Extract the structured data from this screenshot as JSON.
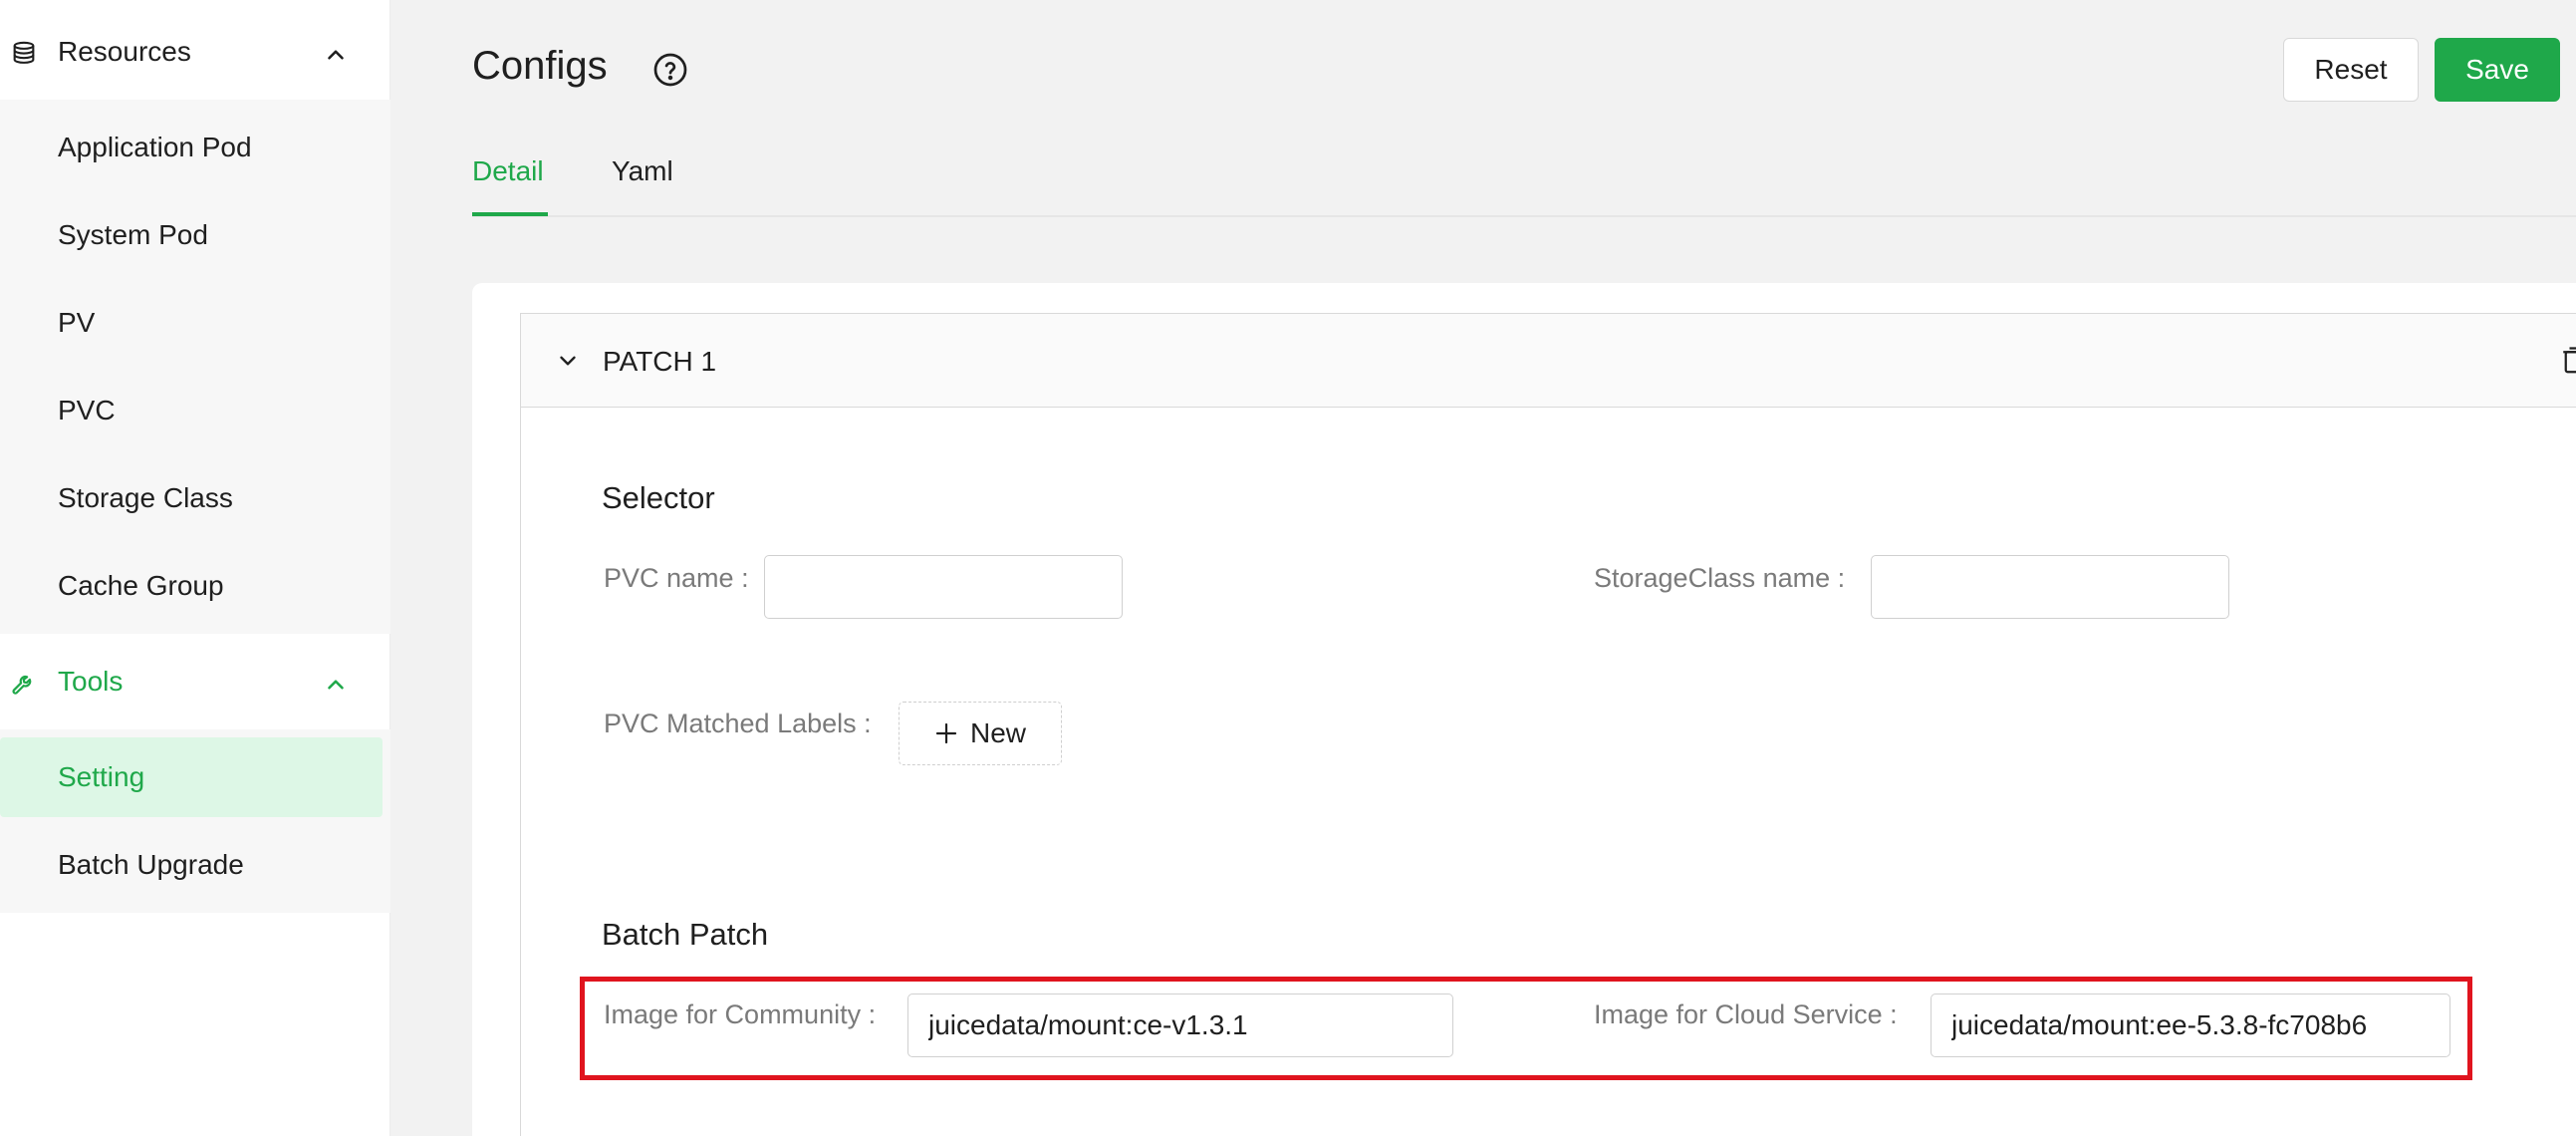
{
  "sidebar": {
    "resources": {
      "label": "Resources",
      "items": [
        {
          "label": "Application Pod"
        },
        {
          "label": "System Pod"
        },
        {
          "label": "PV"
        },
        {
          "label": "PVC"
        },
        {
          "label": "Storage Class"
        },
        {
          "label": "Cache Group"
        }
      ]
    },
    "tools": {
      "label": "Tools",
      "items": [
        {
          "label": "Setting",
          "active": true
        },
        {
          "label": "Batch Upgrade"
        }
      ]
    },
    "accent_color": "#1fa84a"
  },
  "header": {
    "title": "Configs",
    "reset_label": "Reset",
    "save_label": "Save"
  },
  "tabs": [
    {
      "label": "Detail",
      "active": true
    },
    {
      "label": "Yaml",
      "active": false
    }
  ],
  "patch": {
    "title": "PATCH 1",
    "selector": {
      "title": "Selector",
      "pvc_name_label": "PVC name",
      "pvc_name_value": "",
      "storageclass_name_label": "StorageClass name",
      "storageclass_name_value": "",
      "pvc_matched_labels_label": "PVC Matched Labels",
      "new_button_label": "New"
    },
    "batch_patch": {
      "title": "Batch Patch",
      "community_image_label": "Image for Community",
      "community_image_value": "juicedata/mount:ce-v1.3.1",
      "cloud_image_label": "Image for Cloud Service",
      "cloud_image_value": "juicedata/mount:ee-5.3.8-fc708b6"
    }
  }
}
